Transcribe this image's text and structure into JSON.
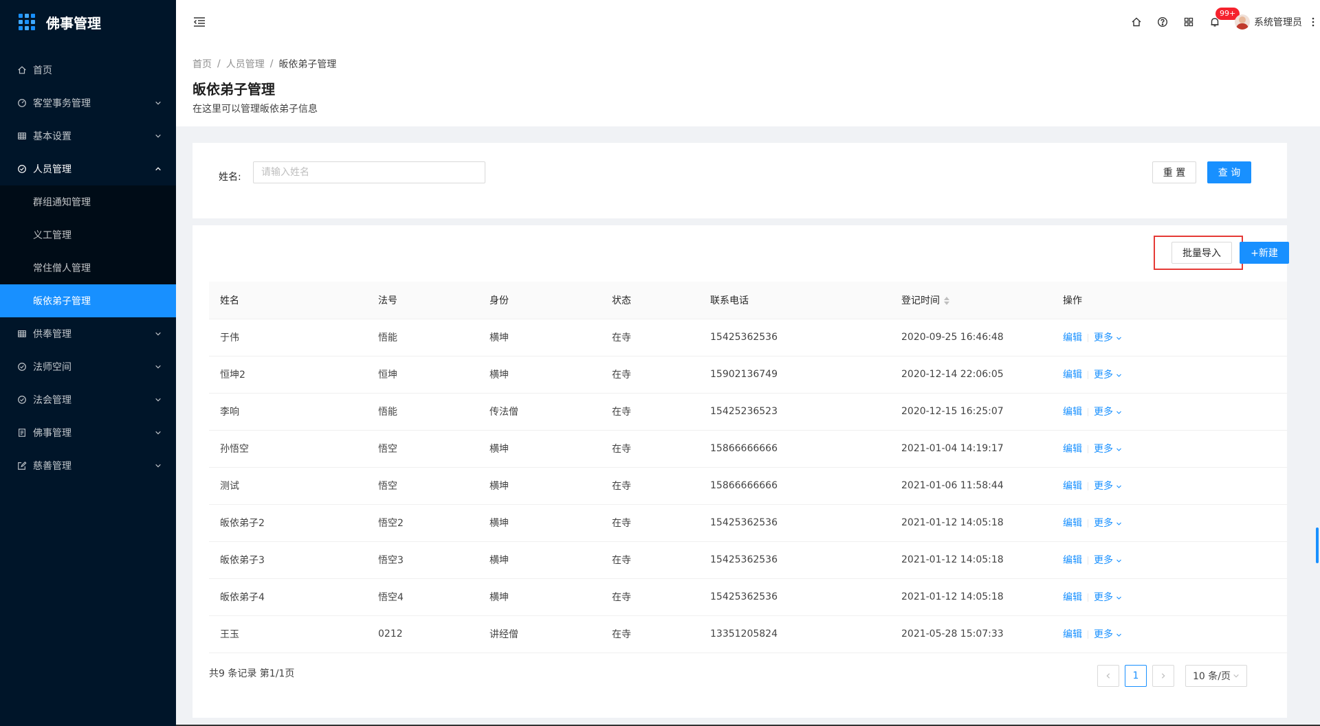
{
  "app": {
    "title": "佛事管理"
  },
  "colors": {
    "sidebar_bg": "#001529",
    "primary": "#1890ff",
    "active_menu": "#1890ff",
    "highlight_border": "#e53935",
    "badge": "#f5222d"
  },
  "sidebar": {
    "items": [
      {
        "label": "首页",
        "icon": "home-icon"
      },
      {
        "label": "客堂事务管理",
        "icon": "dashboard-icon"
      },
      {
        "label": "基本设置",
        "icon": "table-icon"
      },
      {
        "label": "人员管理",
        "icon": "check-circle-icon"
      },
      {
        "label": "供奉管理",
        "icon": "table-icon"
      },
      {
        "label": "法师空间",
        "icon": "check-circle-icon"
      },
      {
        "label": "法会管理",
        "icon": "check-circle-icon"
      },
      {
        "label": "佛事管理",
        "icon": "profile-icon"
      },
      {
        "label": "慈善管理",
        "icon": "form-icon"
      }
    ],
    "sub_items": [
      {
        "label": "群组通知管理"
      },
      {
        "label": "义工管理"
      },
      {
        "label": "常住僧人管理"
      },
      {
        "label": "皈依弟子管理"
      }
    ]
  },
  "header": {
    "notification_count": "99+",
    "user_name": "系统管理员"
  },
  "breadcrumb": [
    "首页",
    "人员管理",
    "皈依弟子管理"
  ],
  "page": {
    "title": "皈依弟子管理",
    "description": "在这里可以管理皈依弟子信息"
  },
  "search": {
    "label": "姓名:",
    "placeholder": "请输入姓名",
    "value": "",
    "reset_label": "重 置",
    "query_label": "查 询"
  },
  "toolbar": {
    "import_label": "批量导入",
    "new_label": "+新建"
  },
  "table": {
    "headers": [
      "姓名",
      "法号",
      "身份",
      "状态",
      "联系电话",
      "登记时间",
      "操作"
    ],
    "edit_label": "编辑",
    "more_label": "更多",
    "rows": [
      {
        "name": "于伟",
        "dharma": "悟能",
        "identity": "横坤",
        "status": "在寺",
        "phone": "15425362536",
        "time": "2020-09-25 16:46:48"
      },
      {
        "name": "恒坤2",
        "dharma": "恒坤",
        "identity": "横坤",
        "status": "在寺",
        "phone": "15902136749",
        "time": "2020-12-14 22:06:05"
      },
      {
        "name": "李响",
        "dharma": "悟能",
        "identity": "传法僧",
        "status": "在寺",
        "phone": "15425236523",
        "time": "2020-12-15 16:25:07"
      },
      {
        "name": "孙悟空",
        "dharma": "悟空",
        "identity": "横坤",
        "status": "在寺",
        "phone": "15866666666",
        "time": "2021-01-04 14:19:17"
      },
      {
        "name": "测试",
        "dharma": "悟空",
        "identity": "横坤",
        "status": "在寺",
        "phone": "15866666666",
        "time": "2021-01-06 11:58:44"
      },
      {
        "name": "皈依弟子2",
        "dharma": "悟空2",
        "identity": "横坤",
        "status": "在寺",
        "phone": "15425362536",
        "time": "2021-01-12 14:05:18"
      },
      {
        "name": "皈依弟子3",
        "dharma": "悟空3",
        "identity": "横坤",
        "status": "在寺",
        "phone": "15425362536",
        "time": "2021-01-12 14:05:18"
      },
      {
        "name": "皈依弟子4",
        "dharma": "悟空4",
        "identity": "横坤",
        "status": "在寺",
        "phone": "15425362536",
        "time": "2021-01-12 14:05:18"
      },
      {
        "name": "王玉",
        "dharma": "0212",
        "identity": "讲经僧",
        "status": "在寺",
        "phone": "13351205824",
        "time": "2021-05-28 15:07:33"
      }
    ]
  },
  "pagination": {
    "total_text": "共9 条记录 第1/1页",
    "current_page": "1",
    "page_size": "10 条/页"
  }
}
